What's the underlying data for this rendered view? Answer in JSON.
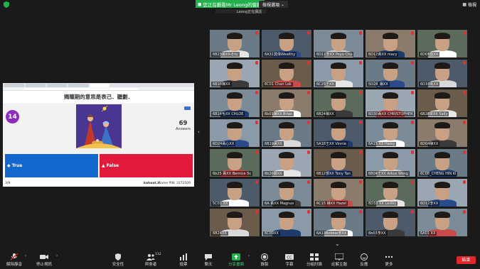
{
  "top": {
    "share_banner": "您正在觀看Mr Leong的螢幕",
    "view_options": "檢視選項",
    "view": "檢視",
    "presenter_tag": "Leong正在講話"
  },
  "share": {
    "question": "揭瞳期的意思是表己．聽劃．",
    "timer": "14",
    "answers_count": "69",
    "answers_label": "Answers",
    "answer_true": "True",
    "answer_false": "False",
    "progress": "3/9",
    "kahoot_url": "kahoot.it",
    "game_pin": "Game PIN: 3372509"
  },
  "tiles": [
    [
      "6B23黃XX-Eric",
      "6A31莫偉Wealthy",
      "6D11李XX Poyo Chu",
      "6D12黃XX macy",
      "6D05莫XX"
    ],
    [
      "6B18陳XX",
      "6C01 Chan Lok",
      "6C25王XX",
      "5D28_楊XX",
      "6D33馬XX"
    ],
    [
      "6B14毛XX CHLOE",
      "6b01陳XX Brian",
      "6B24楊XX",
      "6D30黃XX CHRISTOPHER",
      "6B28梁XX Sally"
    ],
    [
      "6D24黃心XX",
      "6B19黃XX",
      "5A18王XX Vinnie",
      "6A15 XX Haley",
      "6D04陳XX"
    ],
    [
      "6b25 黃XX Bernice 5c",
      "6b20鄭XX",
      "6B12鄧XX Tony Tan",
      "6B04王XX Arkus Wong",
      "6C08_CHENG HIN KI"
    ],
    [
      "5C01 XX",
      "6A 黃XX Magnus",
      "6C15 楊XX Hazel",
      "6D33 XX Lesley",
      "6D12李XX"
    ],
    [
      "6B24XX",
      "6C09XX",
      "6A13Bobbie李XX",
      "6b03李XX",
      "6A01 XX"
    ]
  ],
  "toolbar": {
    "mute": "解除靜音",
    "video": "停止視訊",
    "security": "安全性",
    "participants": "與會者",
    "participants_count": "112",
    "polls": "投票",
    "chat": "聊天",
    "share": "分享畫面",
    "record": "錄製",
    "captions": "字幕",
    "breakout": "分組討論",
    "whiteboard": "註解主題",
    "reactions": "反應",
    "more": "更多",
    "end": "結束"
  },
  "colors": {
    "share_banner": "#23b14d",
    "answer_true": "#1368ce",
    "answer_false": "#e21b3c",
    "timer": "#8e2bbf",
    "end_button": "#e02828"
  }
}
